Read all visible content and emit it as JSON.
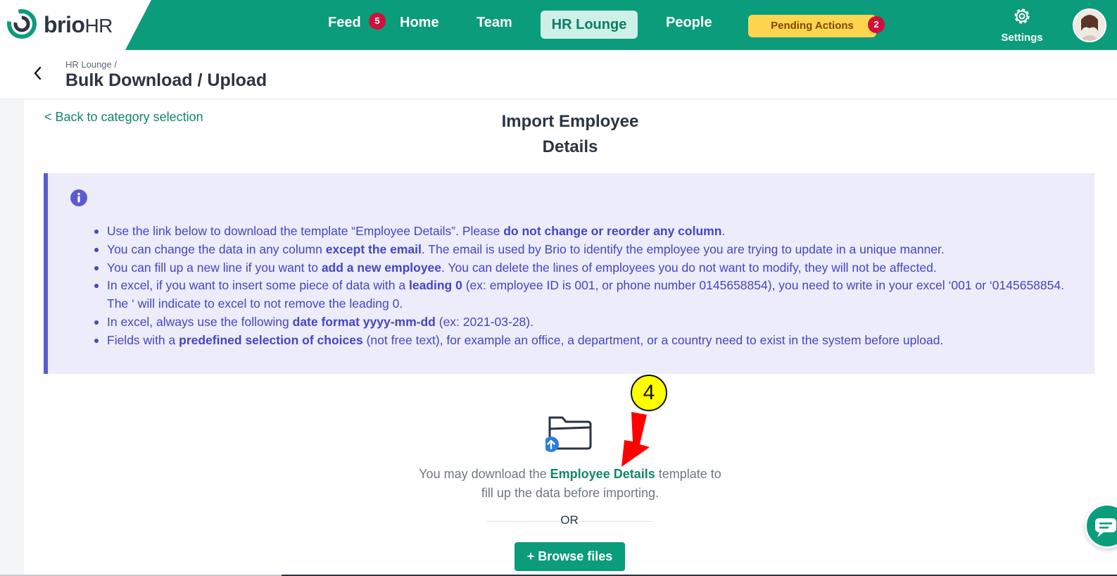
{
  "brand": {
    "name_main": "brio",
    "name_suffix": "HR",
    "accent": "#0a9c7b"
  },
  "nav": {
    "feed": {
      "label": "Feed",
      "badge": "5"
    },
    "home": "Home",
    "team": "Team",
    "hr_lounge": "HR Lounge",
    "people": "People",
    "pending": {
      "label": "Pending Actions",
      "badge": "2"
    },
    "settings": "Settings"
  },
  "header": {
    "breadcrumb": "HR Lounge  /",
    "title": "Bulk Download / Upload"
  },
  "main": {
    "back_link": "< Back to category selection",
    "title_line1": "Import Employee",
    "title_line2": "Details",
    "info": {
      "items": [
        {
          "parts": [
            {
              "t": "Use the link below to download the template “Employee Details”. Please ",
              "b": false
            },
            {
              "t": "do not change or reorder any column",
              "b": true
            },
            {
              "t": ".",
              "b": false
            }
          ]
        },
        {
          "parts": [
            {
              "t": "You can change the data in any column ",
              "b": false
            },
            {
              "t": "except the email",
              "b": true
            },
            {
              "t": ". The email is used by Brio to identify the employee you are trying to update in a unique manner.",
              "b": false
            }
          ]
        },
        {
          "parts": [
            {
              "t": "You can fill up a new line if you want to ",
              "b": false
            },
            {
              "t": "add a new employee",
              "b": true
            },
            {
              "t": ". You can delete the lines of employees you do not want to modify, they will not be affected.",
              "b": false
            }
          ]
        },
        {
          "parts": [
            {
              "t": "In excel, if you want to insert some piece of data with a ",
              "b": false
            },
            {
              "t": "leading 0",
              "b": true
            },
            {
              "t": " (ex: employee ID is 001, or phone number 0145658854), you need to write in your excel ‘001 or ‘0145658854. The ‘ will indicate to excel to not remove the leading 0.",
              "b": false
            }
          ]
        },
        {
          "parts": [
            {
              "t": "In excel, always use the following ",
              "b": false
            },
            {
              "t": "date format yyyy-mm-dd",
              "b": true
            },
            {
              "t": " (ex: 2021-03-28).",
              "b": false
            }
          ]
        },
        {
          "parts": [
            {
              "t": "Fields with a ",
              "b": false
            },
            {
              "t": "predefined selection of choices",
              "b": true
            },
            {
              "t": " (not free text), for example an office, a department, or a country need to exist in the system before upload.",
              "b": false
            }
          ]
        }
      ]
    },
    "download": {
      "prefix": "You may download the ",
      "link": "Employee Details",
      "suffix": " template to fill up the data before importing."
    },
    "or": "OR",
    "browse": "+ Browse files"
  },
  "annotation": {
    "step": "4",
    "color": "#ffff00",
    "arrow_color": "#ff0000"
  }
}
